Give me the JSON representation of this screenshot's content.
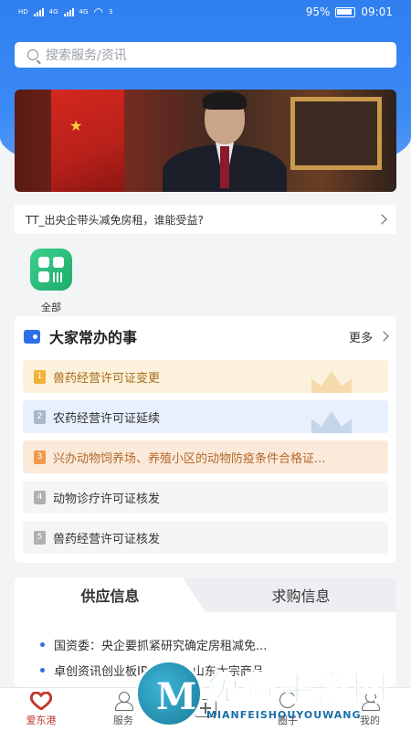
{
  "status_bar": {
    "left_labels": [
      "HD",
      "4G",
      "4G"
    ],
    "wifi_superscript": "3",
    "battery_percent": "95%",
    "time": "09:01"
  },
  "search": {
    "placeholder": "搜索服务/资讯",
    "icon": "search-icon"
  },
  "news_ticker": {
    "text": "TT_出央企带头减免房租，谁能受益?"
  },
  "quick_entry": {
    "label": "全部",
    "icon": "grid-icon",
    "color": "#26bd79"
  },
  "common_tasks": {
    "title": "大家常办的事",
    "more_label": "更多",
    "items": [
      {
        "rank": "1",
        "label": "兽药经营许可证变更"
      },
      {
        "rank": "2",
        "label": "农药经营许可证延续"
      },
      {
        "rank": "3",
        "label": "兴办动物饲养场、养殖小区的动物防疫条件合格证..."
      },
      {
        "rank": "4",
        "label": "动物诊疗许可证核发"
      },
      {
        "rank": "5",
        "label": "兽药经营许可证核发"
      }
    ]
  },
  "info_tabs": {
    "tabs": [
      {
        "label": "供应信息",
        "active": true
      },
      {
        "label": "求购信息",
        "active": false
      }
    ],
    "items": [
      "国资委：央企要抓紧研究确定房租减免...",
      "卓创资讯创业板IPO过会，山东大宗商品..."
    ]
  },
  "bottom_nav": {
    "items": [
      {
        "label": "爱东港",
        "icon": "heart-icon",
        "active": true
      },
      {
        "label": "服务",
        "icon": "user-icon",
        "active": false
      },
      {
        "label": "",
        "icon": "plus-icon",
        "active": false
      },
      {
        "label": "圈子",
        "icon": "circle-icon",
        "active": false
      },
      {
        "label": "我的",
        "icon": "profile-icon",
        "active": false
      }
    ]
  },
  "watermark": {
    "logo_letter": "M",
    "title": "免费手游网",
    "subtitle": "MIANFEISHOUYOUWANG"
  },
  "colors": {
    "primary_blue": "#2f7ff0",
    "active_nav": "#c0392b",
    "rank1": "#f0b23a",
    "rank3": "#ef9a4d"
  }
}
